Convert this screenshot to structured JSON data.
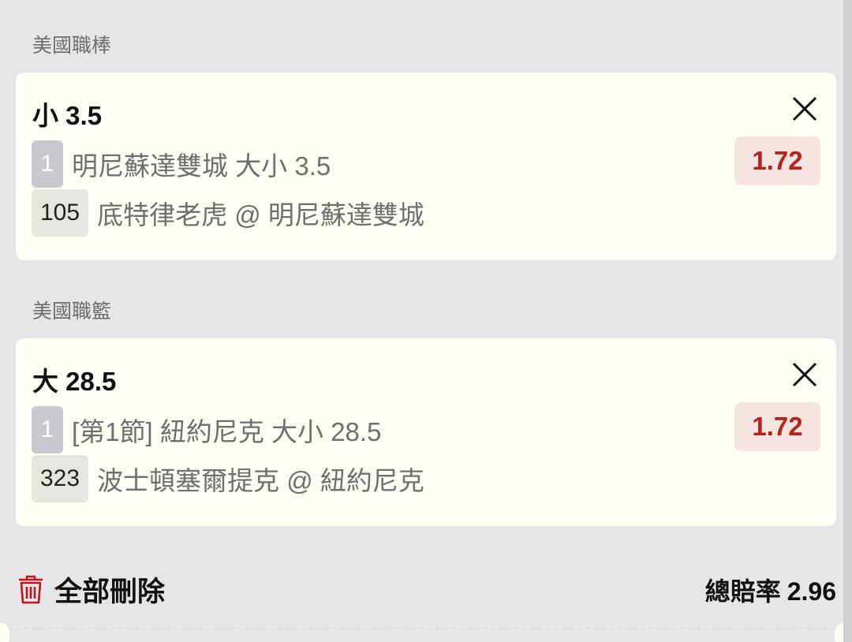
{
  "bets": [
    {
      "league": "美國職棒",
      "selection": "小 3.5",
      "seq": "1",
      "market": "明尼蘇達雙城 大小 3.5",
      "match_id": "105",
      "matchup": "底特律老虎 @ 明尼蘇達雙城",
      "odds": "1.72"
    },
    {
      "league": "美國職籃",
      "selection": "大 28.5",
      "seq": "1",
      "market": "[第1節] 紐約尼克 大小 28.5",
      "match_id": "323",
      "matchup": "波士頓塞爾提克 @ 紐約尼克",
      "odds": "1.72"
    }
  ],
  "footer": {
    "delete_all_label": "全部刪除",
    "total_odds_label": "總賠率",
    "total_odds_value": "2.96"
  },
  "colors": {
    "odds_text": "#b5231c",
    "odds_bg": "#f6e4e0",
    "card_bg": "#fffef4",
    "page_bg": "#e6e6e8",
    "trash_icon": "#c0141c"
  },
  "icons": {
    "close": "close-icon",
    "delete": "trash-icon"
  }
}
